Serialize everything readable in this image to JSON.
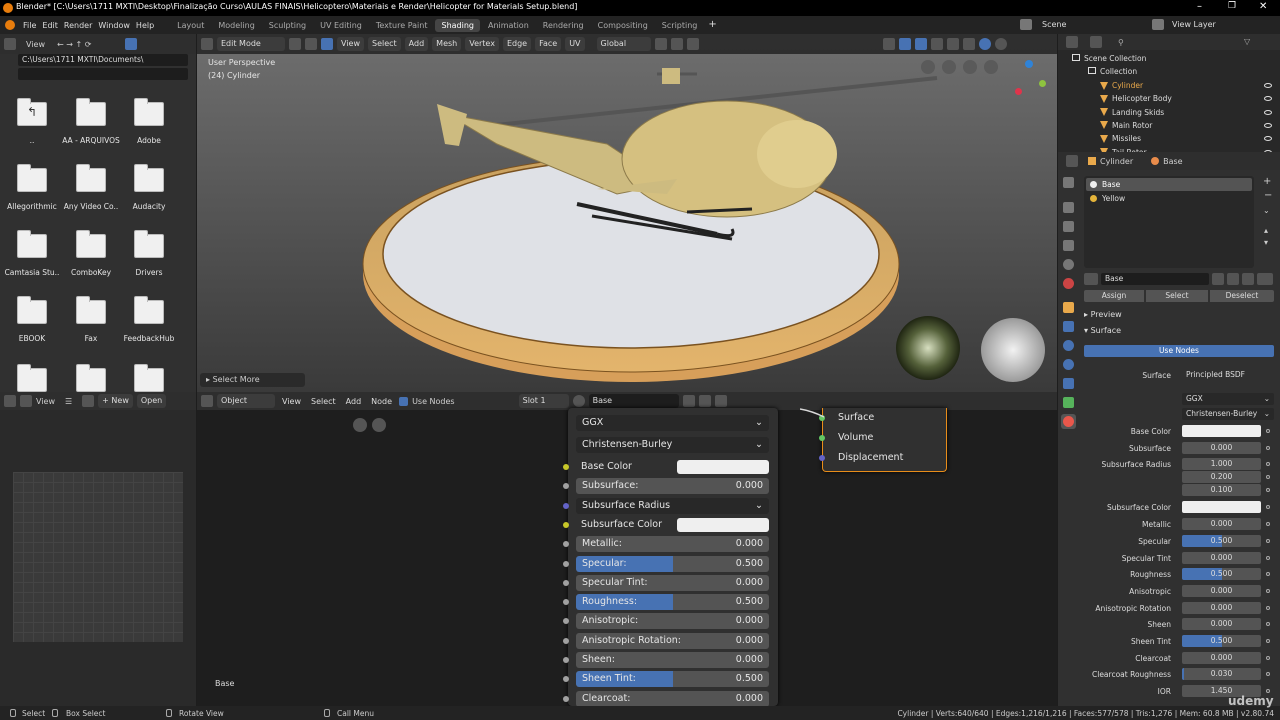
{
  "titlebar": {
    "title": "Blender* [C:\\Users\\1711 MXTI\\Desktop\\Finalização Curso\\AULAS FINAIS\\Helicoptero\\Materiais e Render\\Helicopter for Materials Setup.blend]"
  },
  "menu": [
    "File",
    "Edit",
    "Render",
    "Window",
    "Help"
  ],
  "workspaces": [
    "Layout",
    "Modeling",
    "Sculpting",
    "UV Editing",
    "Texture Paint",
    "Shading",
    "Animation",
    "Rendering",
    "Compositing",
    "Scripting"
  ],
  "active_workspace": "Shading",
  "scene": "Scene",
  "view_layer": "View Layer",
  "file_browser": {
    "view_label": "View",
    "path": "C:\\Users\\1711 MXTI\\Documents\\",
    "items": [
      {
        "name": ".."
      },
      {
        "name": "AA - ARQUIVOS"
      },
      {
        "name": "Adobe"
      },
      {
        "name": "Allegorithmic"
      },
      {
        "name": "Any Video Co.."
      },
      {
        "name": "Audacity"
      },
      {
        "name": "Camtasia Stu.."
      },
      {
        "name": "ComboKey"
      },
      {
        "name": "Drivers"
      },
      {
        "name": "EBOOK"
      },
      {
        "name": "Fax"
      },
      {
        "name": "FeedbackHub"
      },
      {
        "name": ""
      },
      {
        "name": ""
      },
      {
        "name": ""
      }
    ]
  },
  "viewport": {
    "mode": "Edit Mode",
    "menus": [
      "View",
      "Select",
      "Add",
      "Mesh",
      "Vertex",
      "Edge",
      "Face",
      "UV"
    ],
    "orientation": "Global",
    "overlay_title": "User Perspective",
    "overlay_sub": "(24) Cylinder",
    "select_more": "Select More"
  },
  "image_editor": {
    "menus": [
      "View",
      "New",
      "Open"
    ]
  },
  "node_editor": {
    "object_label": "Object",
    "menus": [
      "View",
      "Select",
      "Add",
      "Node"
    ],
    "use_nodes": "Use Nodes",
    "slot": "Slot 1",
    "material": "Base",
    "frame_label": "Base",
    "output_sockets": [
      "Surface",
      "Volume",
      "Displacement"
    ],
    "distribution": "GGX",
    "subsurface_method": "Christensen-Burley",
    "rows": [
      {
        "label": "Base Color",
        "type": "color"
      },
      {
        "label": "Subsurface:",
        "value": "0.000"
      },
      {
        "label": "Subsurface Radius",
        "type": "dropdown"
      },
      {
        "label": "Subsurface Color",
        "type": "color"
      },
      {
        "label": "Metallic:",
        "value": "0.000"
      },
      {
        "label": "Specular:",
        "value": "0.500",
        "fill": 0.5
      },
      {
        "label": "Specular Tint:",
        "value": "0.000"
      },
      {
        "label": "Roughness:",
        "value": "0.500",
        "fill": 0.5
      },
      {
        "label": "Anisotropic:",
        "value": "0.000"
      },
      {
        "label": "Anisotropic Rotation:",
        "value": "0.000"
      },
      {
        "label": "Sheen:",
        "value": "0.000"
      },
      {
        "label": "Sheen Tint:",
        "value": "0.500",
        "fill": 0.5
      },
      {
        "label": "Clearcoat:",
        "value": "0.000"
      }
    ]
  },
  "outliner": {
    "root": "Scene Collection",
    "collection": "Collection",
    "items": [
      "Cylinder",
      "Helicopter Body",
      "Landing Skids",
      "Main Rotor",
      "Missiles",
      "Tail Rotor"
    ],
    "active": "Cylinder"
  },
  "properties": {
    "object": "Cylinder",
    "material": "Base",
    "slots": [
      "Base",
      "Yellow"
    ],
    "mat_field": "Base",
    "assign": "Assign",
    "select": "Select",
    "deselect": "Deselect",
    "preview": "Preview",
    "surface_panel": "Surface",
    "use_nodes": "Use Nodes",
    "surface_label": "Surface",
    "surface_shader": "Principled BSDF",
    "distribution": "GGX",
    "subsurface_method": "Christensen-Burley",
    "fields": [
      {
        "label": "Base Color",
        "type": "color"
      },
      {
        "label": "Subsurface",
        "value": "0.000"
      },
      {
        "label": "Subsurface Radius",
        "value": "1.000"
      },
      {
        "label": "",
        "value": "0.200"
      },
      {
        "label": "",
        "value": "0.100"
      },
      {
        "label": "Subsurface Color",
        "type": "color"
      },
      {
        "label": "Metallic",
        "value": "0.000"
      },
      {
        "label": "Specular",
        "value": "0.500",
        "fill": 0.5
      },
      {
        "label": "Specular Tint",
        "value": "0.000"
      },
      {
        "label": "Roughness",
        "value": "0.500",
        "fill": 0.5
      },
      {
        "label": "Anisotropic",
        "value": "0.000"
      },
      {
        "label": "Anisotropic Rotation",
        "value": "0.000"
      },
      {
        "label": "Sheen",
        "value": "0.000"
      },
      {
        "label": "Sheen Tint",
        "value": "0.500",
        "fill": 0.5
      },
      {
        "label": "Clearcoat",
        "value": "0.000"
      },
      {
        "label": "Clearcoat Roughness",
        "value": "0.030",
        "fill": 0.03
      },
      {
        "label": "IOR",
        "value": "1.450"
      }
    ]
  },
  "statusbar": {
    "select": "Select",
    "box_select": "Box Select",
    "rotate": "Rotate View",
    "call_menu": "Call Menu",
    "stats": "Cylinder | Verts:640/640 | Edges:1,216/1,216 | Faces:577/578 | Tris:1,276 | Mem: 60.8 MB | v2.80.74"
  },
  "watermark": "udemy",
  "colors": {
    "accent": "#4772b3",
    "object": "#e9a94b",
    "header": "#2e2e2e",
    "panel": "#303030"
  }
}
